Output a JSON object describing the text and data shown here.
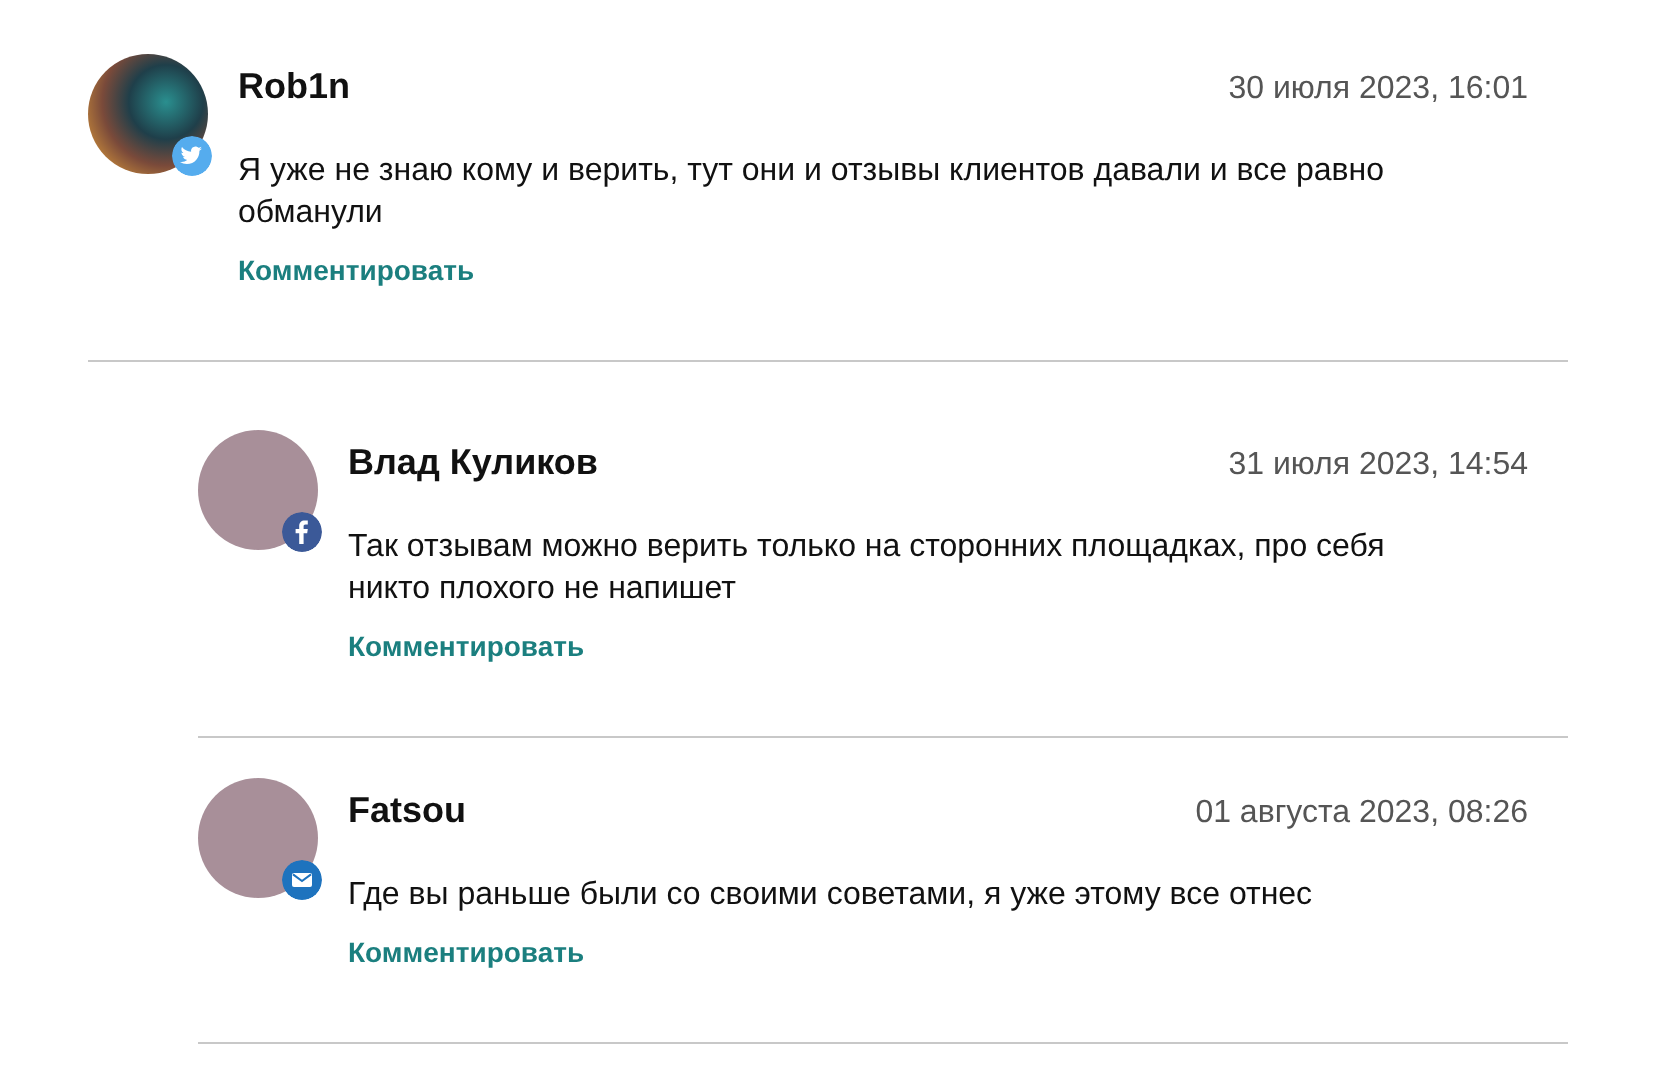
{
  "comments": [
    {
      "author": "Rob1n",
      "date": "30 июля 2023, 16:01",
      "avatar": {
        "kind": "photo"
      },
      "badge": {
        "kind": "twitter"
      },
      "text": "Я уже не знаю кому и верить, тут они и отзывы клиентов давали и все равно обманули",
      "action": "Комментировать",
      "children": [
        {
          "author": "Влад Куликов",
          "date": "31 июля 2023, 14:54",
          "avatar": {
            "kind": "plain"
          },
          "badge": {
            "kind": "facebook"
          },
          "text": "Так отзывам можно верить только на сторонних площадках, про себя никто плохого не напишет",
          "action": "Комментировать"
        },
        {
          "author": "Fatsou",
          "date": "01 августа 2023, 08:26",
          "avatar": {
            "kind": "plain"
          },
          "badge": {
            "kind": "email"
          },
          "text": "Где вы раньше были со своими советами, я уже этому все отнес",
          "action": "Комментировать"
        }
      ]
    }
  ]
}
